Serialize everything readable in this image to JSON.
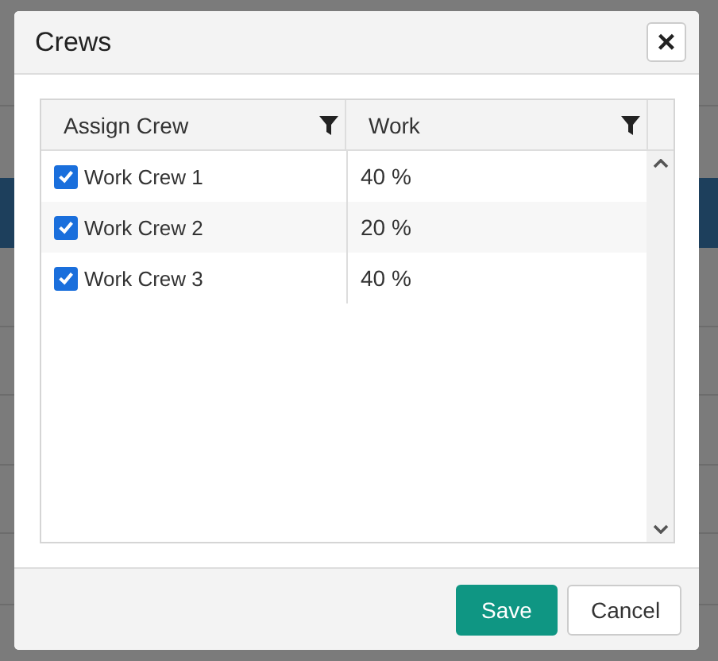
{
  "dialog": {
    "title": "Crews",
    "close": "×"
  },
  "grid": {
    "columns": [
      {
        "label": "Assign Crew"
      },
      {
        "label": "Work"
      }
    ],
    "rows": [
      {
        "crew": "Work Crew 1",
        "checked": true,
        "work": "40 %"
      },
      {
        "crew": "Work Crew 2",
        "checked": true,
        "work": "20 %"
      },
      {
        "crew": "Work Crew 3",
        "checked": true,
        "work": "40 %"
      }
    ]
  },
  "buttons": [
    {
      "label": "Save",
      "kind": "primary"
    },
    {
      "label": "Cancel",
      "kind": "default"
    }
  ]
}
